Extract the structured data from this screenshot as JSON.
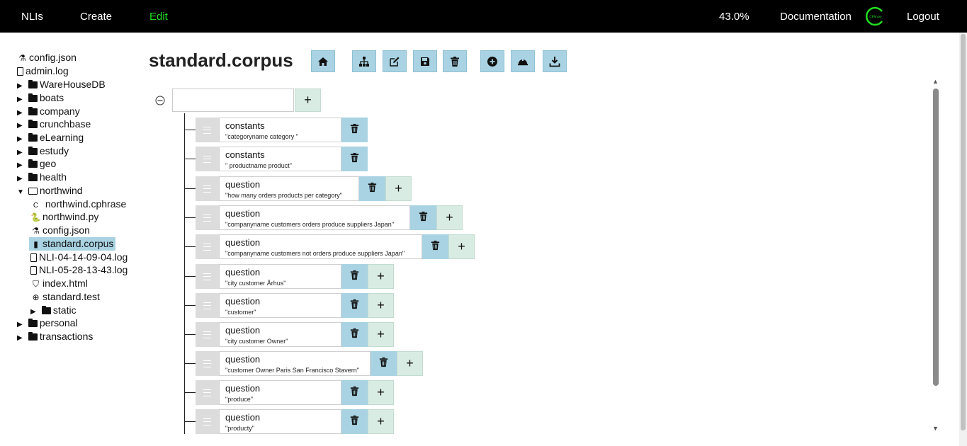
{
  "navbar": {
    "nlis": "NLIs",
    "create": "Create",
    "edit": "Edit",
    "progress": "43.0%",
    "documentation": "Documentation",
    "logo_text": "CPhrase",
    "logout": "Logout",
    "active_color": "#22dd22"
  },
  "tree": {
    "items": [
      {
        "label": "config.json"
      },
      {
        "label": "admin.log"
      },
      {
        "label": "WareHouseDB"
      },
      {
        "label": "boats"
      },
      {
        "label": "company"
      },
      {
        "label": "crunchbase"
      },
      {
        "label": "eLearning"
      },
      {
        "label": "estudy"
      },
      {
        "label": "geo"
      },
      {
        "label": "health"
      },
      {
        "label": "northwind"
      },
      {
        "label": "northwind.cphrase"
      },
      {
        "label": "northwind.py"
      },
      {
        "label": "config.json"
      },
      {
        "label": "standard.corpus"
      },
      {
        "label": "NLI-04-14-09-04.log"
      },
      {
        "label": "NLI-05-28-13-43.log"
      },
      {
        "label": "index.html"
      },
      {
        "label": "standard.test"
      },
      {
        "label": "static"
      },
      {
        "label": "personal"
      },
      {
        "label": "transactions"
      }
    ]
  },
  "main": {
    "title": "standard.corpus",
    "root_input_value": "",
    "entries": [
      {
        "type": "constants",
        "text": "\"categoryname category \""
      },
      {
        "type": "constants",
        "text": "\" productname product\""
      },
      {
        "type": "question",
        "text": "\"how many orders products per category\""
      },
      {
        "type": "question",
        "text": "\"companyname customers orders produce suppliers Japan\""
      },
      {
        "type": "question",
        "text": "\"companyname customers not orders produce suppliers Japan\""
      },
      {
        "type": "question",
        "text": "\"city customer Århus\""
      },
      {
        "type": "question",
        "text": "\"customer\""
      },
      {
        "type": "question",
        "text": "\"city customer Owner\""
      },
      {
        "type": "question",
        "text": "\"customer Owner Paris San Francisco Stavern\""
      },
      {
        "type": "question",
        "text": "\"produce\""
      },
      {
        "type": "question",
        "text": "\"producty\""
      }
    ]
  },
  "icons": {
    "toolbar": [
      "home-icon",
      "sitemap-icon",
      "edit-icon",
      "save-icon",
      "trash-icon",
      "add-circle-icon",
      "hard-hat-icon",
      "download-icon"
    ]
  },
  "colors": {
    "button_blue": "#a9d3e3",
    "button_green": "#d9ece3",
    "drag_gray": "#dcdcdc"
  }
}
